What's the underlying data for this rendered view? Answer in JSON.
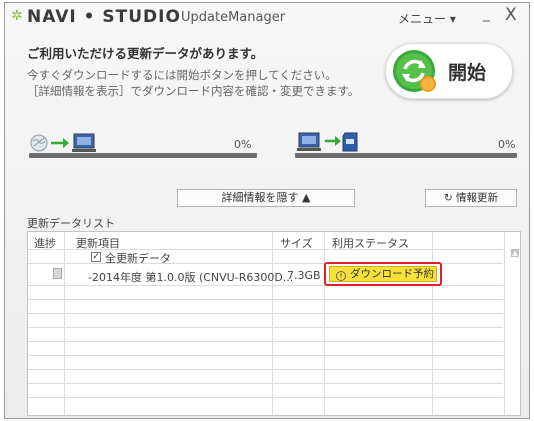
{
  "window": {
    "brand": "NAVI STUDIO",
    "brand_sep": "•",
    "app_name": "UpdateManager",
    "menu_label": "メニュー ▾",
    "minimize_glyph": "_",
    "close_glyph": "X"
  },
  "message": {
    "headline": "ご利用いただける更新データがあります。",
    "line1": "今すぐダウンロードするには開始ボタンを押してください。",
    "line2": "［詳細情報を表示］でダウンロード内容を確認・変更できます。"
  },
  "start_button": {
    "label": "開始"
  },
  "progress": {
    "download": {
      "percent_label": "0%",
      "value": 0
    },
    "transfer": {
      "percent_label": "0%",
      "value": 0
    }
  },
  "buttons": {
    "detail_toggle": "詳細情報を隠す ▲",
    "refresh": "↻ 情報更新"
  },
  "update_list": {
    "title": "更新データリスト",
    "columns": [
      "進捗",
      "更新項目",
      "サイズ",
      "利用ステータス"
    ],
    "group_row": {
      "checked": true,
      "label": "全更新データ"
    },
    "rows": [
      {
        "item": "-2014年度 第1.0.0版 (CNVU-R6300D...",
        "size": "7.3GB",
        "status": "ダウンロード予約"
      }
    ]
  },
  "colors": {
    "accent_green": "#38a838",
    "status_yellow": "#f7e03a",
    "highlight_red": "#e0202a"
  }
}
